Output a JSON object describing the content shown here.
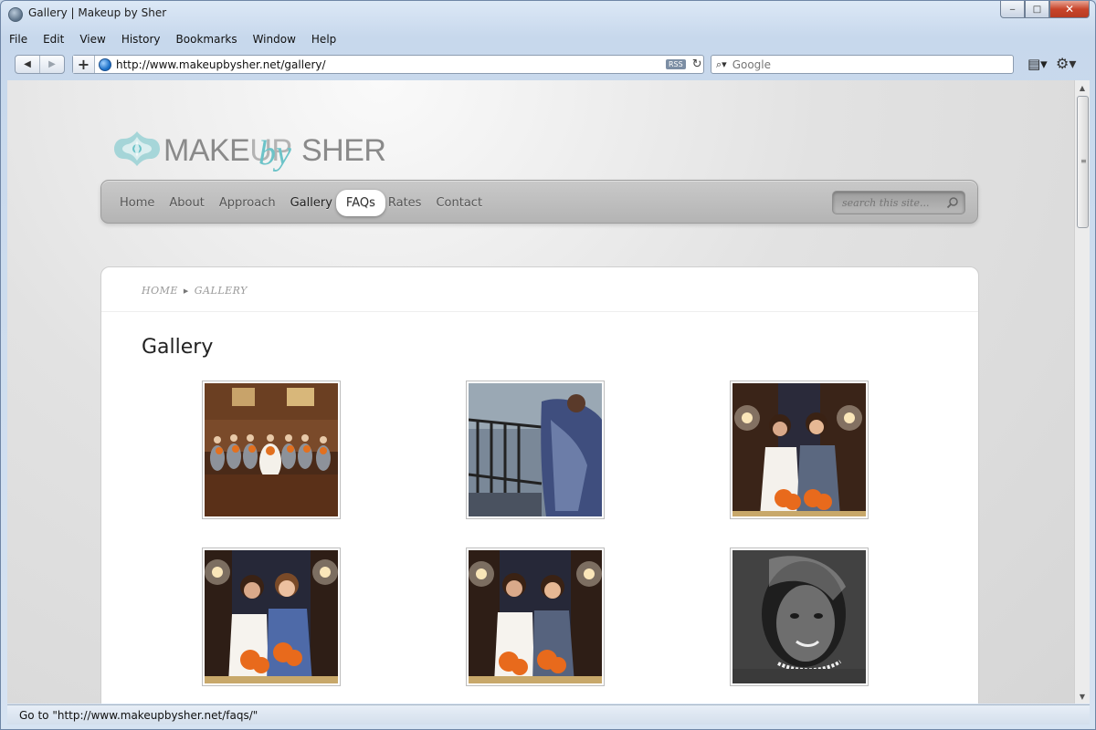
{
  "window": {
    "title": "Gallery | Makeup by Sher",
    "minimize": "‒",
    "maximize": "□",
    "close": "✕"
  },
  "menu": [
    "File",
    "Edit",
    "View",
    "History",
    "Bookmarks",
    "Window",
    "Help"
  ],
  "toolbar": {
    "back": "◀",
    "forward": "▶",
    "add": "+",
    "url": "http://www.makeupbysher.net/gallery/",
    "rss": "RSS",
    "reload": "↻",
    "search_placeholder": "Google",
    "search_glyph": "⌕▾",
    "page_menu": "▤▾",
    "tools_menu": "⚙▾"
  },
  "status": "Go to \"http://www.makeupbysher.net/faqs/\"",
  "site": {
    "logo": {
      "part1": "MAKE",
      "part2": "UP",
      "by": "by",
      "part3": "SHER"
    },
    "nav": [
      "Home",
      "About",
      "Approach",
      "Gallery",
      "FAQs",
      "Rates",
      "Contact"
    ],
    "nav_current": "Gallery",
    "nav_hover": "FAQs",
    "search_placeholder": "search this site...",
    "breadcrumb": [
      "HOME",
      "GALLERY"
    ],
    "page_title": "Gallery",
    "gallery": [
      {
        "name": "bridal-party-photo"
      },
      {
        "name": "makeup-application-photo"
      },
      {
        "name": "bride-bridesmaid-photo-1"
      },
      {
        "name": "bride-bridesmaid-photo-2"
      },
      {
        "name": "bride-bridesmaid-photo-3"
      },
      {
        "name": "bride-portrait-bw-photo"
      }
    ]
  },
  "colors": {
    "brand_teal": "#6cc3c8",
    "nav_bg": "#bdbdbd"
  }
}
